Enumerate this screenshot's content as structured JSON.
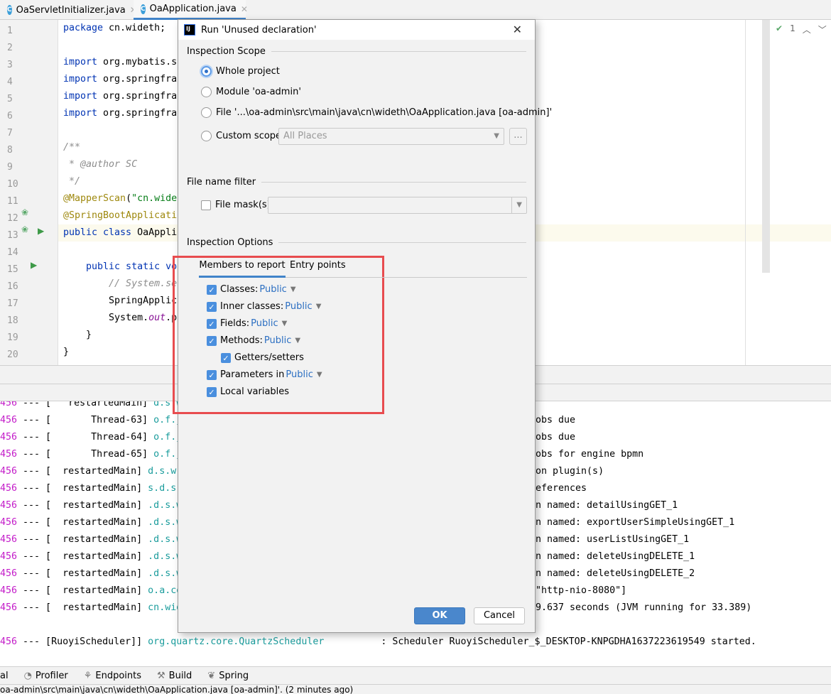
{
  "tabs": [
    {
      "label": "OaServletInitializer.java",
      "icon": "class-icon",
      "active": false
    },
    {
      "label": "OaApplication.java",
      "icon": "spring-app-icon",
      "active": true
    }
  ],
  "editor": {
    "line_numbers": [
      "1",
      "2",
      "3",
      "4",
      "5",
      "6",
      "7",
      "8",
      "9",
      "10",
      "11",
      "12",
      "13",
      "14",
      "15",
      "16",
      "17",
      "18",
      "19",
      "20"
    ],
    "lines": [
      [
        {
          "t": "package ",
          "c": "kw"
        },
        {
          "t": "cn.wideth;"
        }
      ],
      [],
      [
        {
          "t": "import ",
          "c": "kw"
        },
        {
          "t": "org.mybatis.s"
        }
      ],
      [
        {
          "t": "import ",
          "c": "kw"
        },
        {
          "t": "org.springfra"
        }
      ],
      [
        {
          "t": "import ",
          "c": "kw"
        },
        {
          "t": "org.springfra"
        }
      ],
      [
        {
          "t": "import ",
          "c": "kw"
        },
        {
          "t": "org.springfra"
        }
      ],
      [],
      [
        {
          "t": "/**",
          "c": "cm"
        }
      ],
      [
        {
          "t": " * @author SC",
          "c": "cm"
        }
      ],
      [
        {
          "t": " */",
          "c": "cm"
        }
      ],
      [
        {
          "t": "@MapperScan",
          "c": "an"
        },
        {
          "t": "("
        },
        {
          "t": "\"cn.wide",
          "c": "st"
        }
      ],
      [
        {
          "t": "@SpringBootApplicati",
          "c": "an"
        }
      ],
      [
        {
          "t": "public class ",
          "c": "kw"
        },
        {
          "t": "OaAppli"
        }
      ],
      [],
      [
        {
          "t": "    public static vo",
          "c": "kw"
        }
      ],
      [
        {
          "t": "        // System.se",
          "c": "cm"
        }
      ],
      [
        {
          "t": "        SpringApplic"
        }
      ],
      [
        {
          "t": "        System."
        },
        {
          "t": "out",
          "c": "it"
        },
        {
          "t": ".p"
        }
      ],
      [
        {
          "t": "    }"
        }
      ],
      [
        {
          "t": "}"
        }
      ]
    ],
    "inspection_count": "1"
  },
  "console": {
    "rows": [
      {
        "pid": "456",
        "sep": " --- [",
        "thread": "   restartedMain]",
        "logger": " d.s.w.",
        "right": ""
      },
      {
        "pid": "456",
        "sep": " --- [",
        "thread": "       Thread-63]",
        "logger": " o.f.j.",
        "right": "jobs due"
      },
      {
        "pid": "456",
        "sep": " --- [",
        "thread": "       Thread-64]",
        "logger": " o.f.j.",
        "right": "jobs due"
      },
      {
        "pid": "456",
        "sep": " --- [",
        "thread": "       Thread-65]",
        "logger": " o.f.j.",
        "right": "jobs for engine bpmn"
      },
      {
        "pid": "456",
        "sep": " --- [",
        "thread": "  restartedMain]",
        "logger": " d.s.w.",
        "right": "ion plugin(s)"
      },
      {
        "pid": "456",
        "sep": " --- [",
        "thread": "  restartedMain]",
        "logger": " s.d.s.",
        "right": "references"
      },
      {
        "pid": "456",
        "sep": " --- [",
        "thread": "  restartedMain]",
        "logger": " .d.s.w",
        "right": "on named: detailUsingGET_1"
      },
      {
        "pid": "456",
        "sep": " --- [",
        "thread": "  restartedMain]",
        "logger": " .d.s.w",
        "right": "on named: exportUserSimpleUsingGET_1"
      },
      {
        "pid": "456",
        "sep": " --- [",
        "thread": "  restartedMain]",
        "logger": " .d.s.w",
        "right": "on named: userListUsingGET_1"
      },
      {
        "pid": "456",
        "sep": " --- [",
        "thread": "  restartedMain]",
        "logger": " .d.s.w",
        "right": "on named: deleteUsingDELETE_1"
      },
      {
        "pid": "456",
        "sep": " --- [",
        "thread": "  restartedMain]",
        "logger": " .d.s.w",
        "right": "on named: deleteUsingDELETE_2"
      },
      {
        "pid": "456",
        "sep": " --- [",
        "thread": "  restartedMain]",
        "logger": " o.a.co",
        "right": "[\"http-nio-8080\"]"
      },
      {
        "pid": "456",
        "sep": " --- [",
        "thread": "  restartedMain]",
        "logger": " cn.wid",
        "right": "29.637 seconds (JVM running for 33.389)"
      },
      {
        "pid": "",
        "sep": "",
        "thread": "",
        "logger": "",
        "right": ""
      },
      {
        "pid": "456",
        "sep": " --- [",
        "thread": "RuoyiScheduler]]",
        "logger": " org.quartz.core.QuartzScheduler",
        "right": "          : Scheduler RuoyiScheduler_$_DESKTOP-KNPGDHA1637223619549 started."
      }
    ]
  },
  "toolwindows": [
    {
      "label": "al",
      "icon": ""
    },
    {
      "label": "Profiler",
      "icon": "profiler-icon"
    },
    {
      "label": "Endpoints",
      "icon": "endpoints-icon"
    },
    {
      "label": "Build",
      "icon": "hammer-icon"
    },
    {
      "label": "Spring",
      "icon": "spring-leaf-icon"
    }
  ],
  "status_text": "oa-admin\\src\\main\\java\\cn\\wideth\\OaApplication.java [oa-admin]'. (2 minutes ago)",
  "dialog": {
    "title": "Run 'Unused declaration'",
    "scope_header": "Inspection Scope",
    "scope_options": [
      {
        "label": "Whole project",
        "selected": true
      },
      {
        "label": "Module 'oa-admin'",
        "selected": false
      },
      {
        "label": "File '...\\oa-admin\\src\\main\\java\\cn\\wideth\\OaApplication.java [oa-admin]'",
        "selected": false
      },
      {
        "label": "Custom scope",
        "selected": false
      }
    ],
    "custom_scope_value": "All Places",
    "browse_label": "...",
    "filter_header": "File name filter",
    "file_mask_label": "File mask(s)",
    "file_mask_checked": false,
    "options_header": "Inspection Options",
    "subtabs": [
      {
        "label": "Members to report",
        "active": true
      },
      {
        "label": "Entry points",
        "active": false
      }
    ],
    "members": [
      {
        "label": "Classes:",
        "value": "Public",
        "checked": true
      },
      {
        "label": "Inner classes:",
        "value": "Public",
        "checked": true
      },
      {
        "label": "Fields:",
        "value": "Public",
        "checked": true
      },
      {
        "label": "Methods:",
        "value": "Public",
        "checked": true
      },
      {
        "label": "Getters/setters",
        "value": "",
        "checked": true,
        "indent": true
      },
      {
        "label": "Parameters in",
        "value": "Public",
        "checked": true
      },
      {
        "label": "Local variables",
        "value": "",
        "checked": true
      }
    ],
    "ok_label": "OK",
    "cancel_label": "Cancel",
    "highlight_color": "#e84c4f",
    "accent_color": "#4a8fde"
  }
}
